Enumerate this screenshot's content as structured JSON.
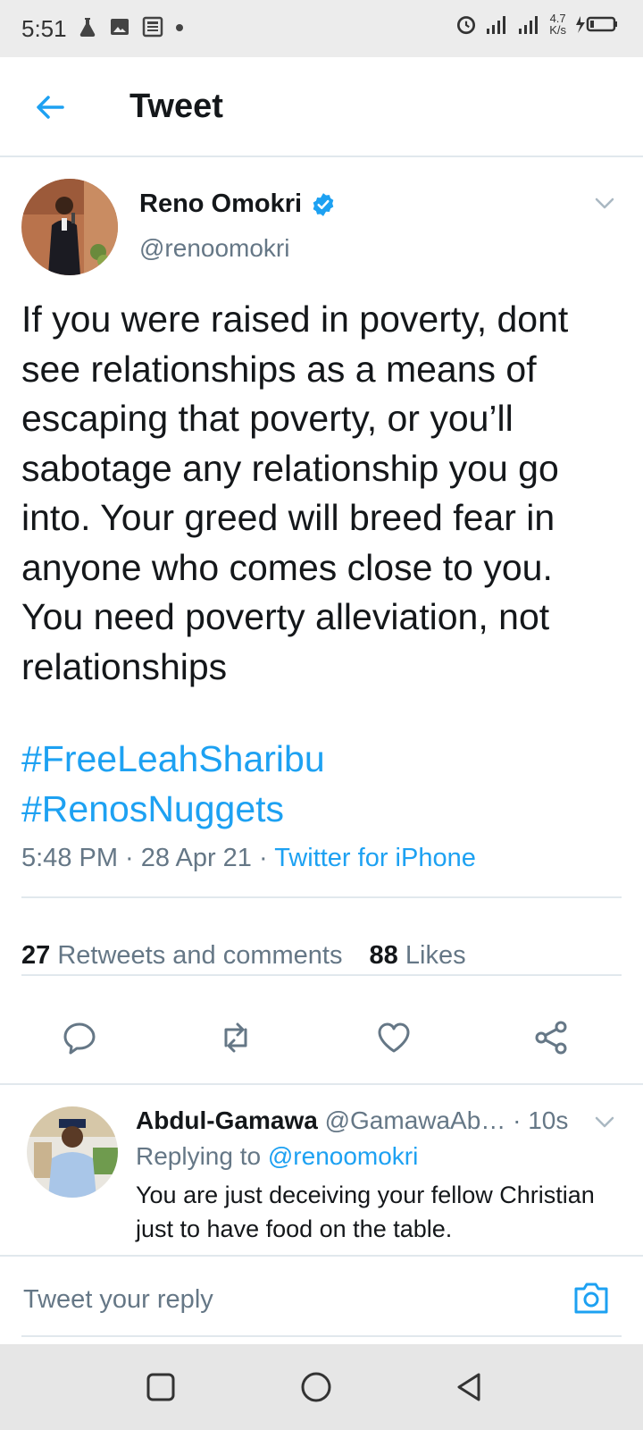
{
  "status_bar": {
    "time": "5:51",
    "network_speed_value": "4.7",
    "network_speed_unit": "K/s"
  },
  "header": {
    "title": "Tweet"
  },
  "tweet": {
    "author_name": "Reno Omokri",
    "author_handle": "@renoomokri",
    "verified": true,
    "text": "If you were raised in poverty, dont see relationships as a means of escaping that poverty, or you’ll sabotage any relationship you go into. Your greed will breed fear in anyone who comes close to you. You need poverty alleviation, not relationships",
    "hashtags": [
      "#FreeLeahSharibu",
      "#RenosNuggets"
    ],
    "time": "5:48 PM",
    "date": "28 Apr 21",
    "source": "Twitter for iPhone",
    "separator": " · ",
    "retweets_count": "27",
    "retweets_label": "Retweets and comments",
    "likes_count": "88",
    "likes_label": "Likes"
  },
  "reply": {
    "author_name": "Abdul-Gamawa",
    "author_handle": "@GamawaAb…",
    "time": "· 10s",
    "replying_to_label": "Replying to",
    "replying_to_handle": "@renoomokri",
    "text": "You are just deceiving your fellow Christian just to have food on the table."
  },
  "compose": {
    "placeholder": "Tweet your reply"
  },
  "colors": {
    "accent": "#1da1f2",
    "text_primary": "#14171a",
    "text_secondary": "#657786",
    "divider": "#e1e8ed"
  },
  "icons": [
    "back-arrow-icon",
    "verified-badge-icon",
    "chevron-down-icon",
    "reply-icon",
    "retweet-icon",
    "like-icon",
    "share-icon",
    "camera-icon"
  ]
}
